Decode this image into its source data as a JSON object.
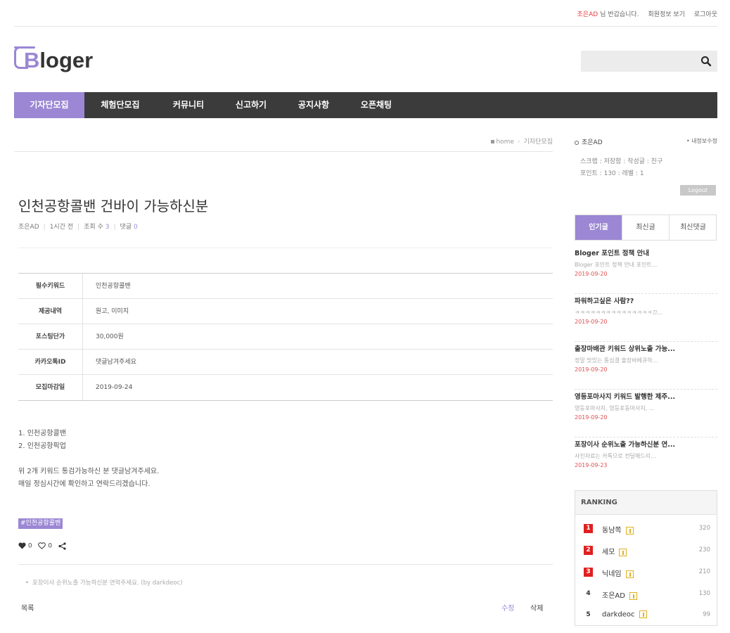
{
  "topbar": {
    "user": "조은AD",
    "greeting": "님 반갑습니다.",
    "profile_link": "회원정보 보기",
    "logout_link": "로그아웃"
  },
  "logo": {
    "b": "B",
    "rest": "loger"
  },
  "nav": {
    "items": [
      {
        "label": "기자단모집",
        "active": true
      },
      {
        "label": "체험단모집"
      },
      {
        "label": "커뮤니티"
      },
      {
        "label": "신고하기"
      },
      {
        "label": "공지사항"
      },
      {
        "label": "오픈채팅"
      }
    ]
  },
  "breadcrumb": {
    "home": "home",
    "current": "기자단모집"
  },
  "post": {
    "title": "인천공항콜밴 건바이 가능하신분",
    "author": "조은AD",
    "time": "1시간 전",
    "views_label": "조회 수",
    "views": "3",
    "comments_label": "댓글",
    "comments": "0",
    "fields": [
      {
        "key": "필수키워드",
        "value": "인천공항콜밴"
      },
      {
        "key": "제공내역",
        "value": "원고, 이미지"
      },
      {
        "key": "포스팅단가",
        "value": "30,000원"
      },
      {
        "key": "카카오톡ID",
        "value": "댓글남겨주세요"
      },
      {
        "key": "모집마감일",
        "value": "2019-09-24"
      }
    ],
    "body_lines": [
      "1. 인천공항콜밴",
      "2. 인천공항픽업",
      "",
      "위 2개 키워드 통검가능하신 분 댓글남겨주세요.",
      "매일 정심시간에 확인하고 연락드리겠습니다."
    ],
    "tag": "#인천공항콜밴",
    "likes": "0",
    "dislikes": "0",
    "comment_preview": "포장이사 순위노출 가능하신분 연락주세요. (by darkdeoc)",
    "list_button": "목록",
    "edit_button": "수정",
    "delete_button": "삭제"
  },
  "user_box": {
    "name": "조은AD",
    "edit_info": "• 내정보수정",
    "line1": "스크랩 : 저장함 : 작성글 : 친구",
    "line2": "포인트 : 130 : 레벨 : 1",
    "logout": "Logout"
  },
  "tabs": [
    {
      "label": "인기글",
      "active": true
    },
    {
      "label": "최신글"
    },
    {
      "label": "최신댓글"
    }
  ],
  "popular_posts": [
    {
      "title": "Bloger 포인트 정책 안내",
      "snippet": "Bloger 포인트 정책 안내 포인트...",
      "date": "2019-09-20"
    },
    {
      "title": "파워하고싶은 사람??",
      "snippet": "ㅋㅋㅋㅋㅋㅋㅋㅋㅋㅋㅋㅋㅋㅋㅋ끄...",
      "date": "2019-09-20"
    },
    {
      "title": "출장마배관 키워드 상위노출 가능...",
      "snippet": "정말 맛있는 통심결 출장바베큐하...",
      "date": "2019-09-20"
    },
    {
      "title": "영등포마사지 키워드 발행한 제주...",
      "snippet": "영등포마사지, 영등포동마사지, ...",
      "date": "2019-09-20"
    },
    {
      "title": "포장이사 순위노출 가능하신분 연...",
      "snippet": "사진자료는 카톡으로 전달해드리...",
      "date": "2019-09-23"
    }
  ],
  "ranking": {
    "title": "RANKING",
    "items": [
      {
        "rank": "1",
        "name": "동남쪽",
        "score": "320"
      },
      {
        "rank": "2",
        "name": "세모",
        "score": "230"
      },
      {
        "rank": "3",
        "name": "닉네임",
        "score": "210"
      },
      {
        "rank": "4",
        "name": "조은AD",
        "score": "130"
      },
      {
        "rank": "5",
        "name": "darkdeoc",
        "score": "99"
      }
    ]
  },
  "colors": {
    "accent": "#9b87d4",
    "nav_bg": "#3b3b3b",
    "alert": "#e02020"
  }
}
